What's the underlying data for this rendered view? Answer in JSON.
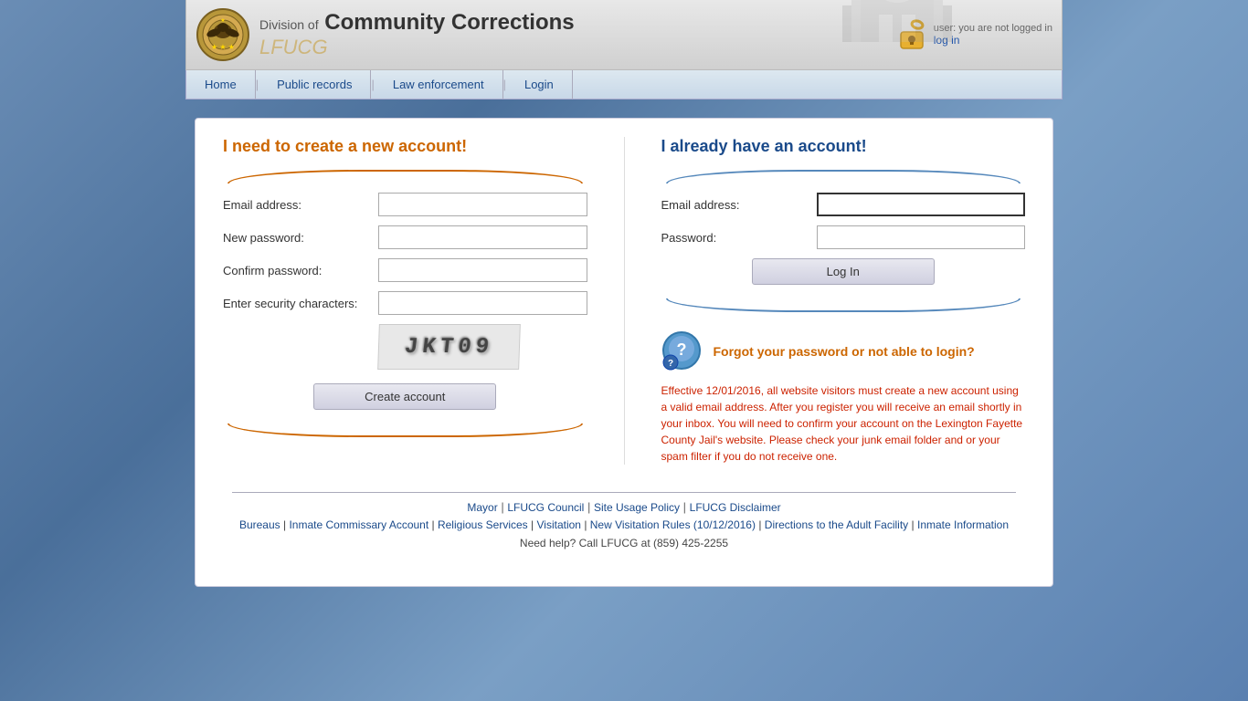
{
  "header": {
    "division_label": "Division of",
    "site_name": "Community Corrections",
    "subtitle": "LFUCG",
    "user_status": "user: you are not logged in",
    "login_link_text": "log in"
  },
  "nav": {
    "items": [
      {
        "label": "Home",
        "href": "#"
      },
      {
        "label": "Public records",
        "href": "#"
      },
      {
        "label": "Law enforcement",
        "href": "#"
      },
      {
        "label": "Login",
        "href": "#"
      }
    ]
  },
  "create_section": {
    "title": "I need to create a new account!",
    "email_label": "Email address:",
    "email_placeholder": "",
    "password_label": "New password:",
    "password_placeholder": "",
    "confirm_label": "Confirm password:",
    "confirm_placeholder": "",
    "security_label": "Enter security characters:",
    "security_placeholder": "",
    "captcha_text": "JKT09",
    "button_label": "Create account"
  },
  "login_section": {
    "title": "I already have an account!",
    "email_label": "Email address:",
    "email_placeholder": "",
    "password_label": "Password:",
    "password_placeholder": "",
    "button_label": "Log In",
    "forgot_title": "Forgot your password or not able to login?",
    "notice_text": "Effective 12/01/2016, all website visitors must create a new account using a valid email address. After you register you will receive an email shortly in your inbox. You will need to confirm your account on the Lexington Fayette County Jail's website. Please check your junk email folder and or your spam filter if you do not receive one."
  },
  "footer": {
    "links_row1": [
      {
        "label": "Mayor"
      },
      {
        "label": "LFUCG Council"
      },
      {
        "label": "Site Usage Policy"
      },
      {
        "label": "LFUCG Disclaimer"
      }
    ],
    "links_row2": [
      {
        "label": "Bureaus"
      },
      {
        "label": "Inmate Commissary Account"
      },
      {
        "label": "Religious Services"
      },
      {
        "label": "Visitation"
      },
      {
        "label": "New Visitation Rules (10/12/2016)"
      },
      {
        "label": "Directions to the Adult Facility"
      },
      {
        "label": "Inmate Information"
      }
    ],
    "help_text": "Need help? Call LFUCG at (859) 425-2255"
  }
}
